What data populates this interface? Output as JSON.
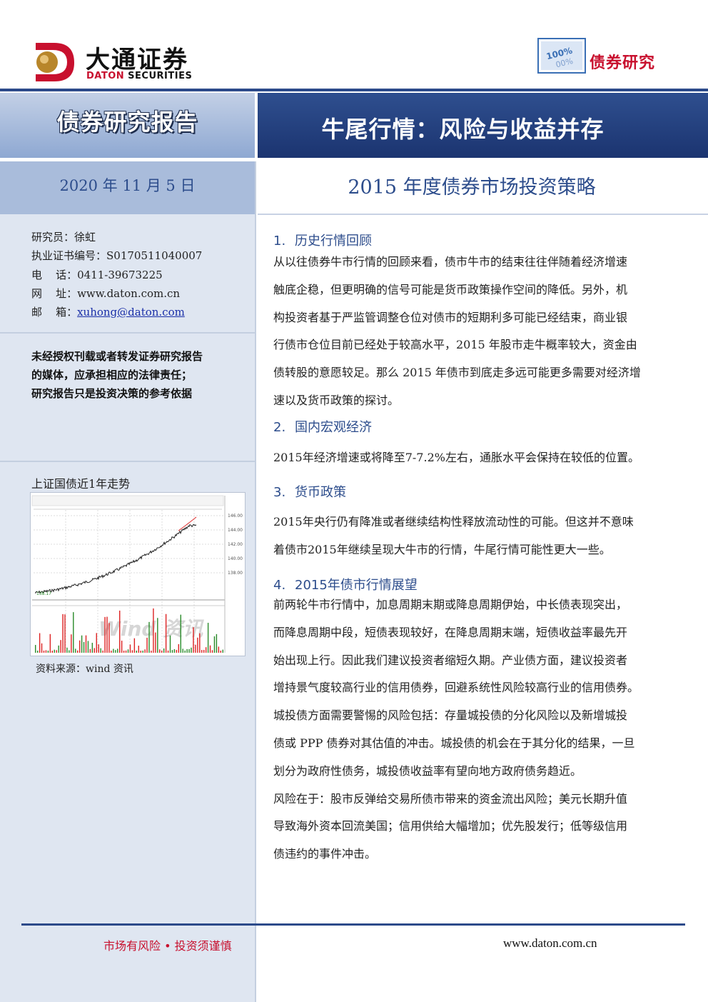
{
  "header": {
    "logo_cn": "大通证券",
    "logo_en_brand": "DATON",
    "logo_en_rest": " SECURITIES",
    "brand_badge_top": "100%",
    "brand_badge_bottom": "00%",
    "brand_text": "债券研究"
  },
  "band": {
    "report_type": "债券研究报告",
    "title": "牛尾行情：风险与收益并存",
    "date": "2020 年 11 月 5 日",
    "subtitle": "2015 年度债券市场投资策略"
  },
  "author": {
    "researcher": "研究员：徐虹",
    "cert": "执业证书编号：S0170511040007",
    "phone": "电    话：0411-39673225",
    "site": "网    址：www.daton.com.cn",
    "email_label": "邮    箱：",
    "email": "xuhong@daton.com"
  },
  "disclaimer": {
    "line1": "未经授权刊载或者转发证券研究报告",
    "line2": "的媒体，应承担相应的法律责任；",
    "line3": "研究报告只是投资决策的参考依据"
  },
  "chart": {
    "title": "上证国债近1年走势",
    "source": "资料来源：wind 资讯",
    "watermark": "Wind 资讯",
    "y_ticks": [
      "146.00",
      "144.00",
      "142.00",
      "140.00",
      "138.00"
    ],
    "start_label": "138.17"
  },
  "sections": [
    {
      "num": "1.",
      "title": "历史行情回顾",
      "lines": [
        "从以往债券牛市行情的回顾来看，债市牛市的结束往往伴随着经济增速",
        "触底企稳，但更明确的信号可能是货币政策操作空间的降低。另外，机",
        "构投资者基于严监管调整仓位对债市的短期利多可能已经结束，商业银",
        "行债市仓位目前已经处于较高水平，2015 年股市走牛概率较大，资金由",
        "债转股的意愿较足。那么 2015 年债市到底走多远可能更多需要对经济增",
        "速以及货币政策的探讨。"
      ]
    },
    {
      "num": "2.",
      "title": "国内宏观经济",
      "lines": [
        "2015年经济增速或将降至7-7.2%左右，通胀水平会保持在较低的位置。"
      ]
    },
    {
      "num": "3.",
      "title": "货币政策",
      "lines": [
        "2015年央行仍有降准或者继续结构性释放流动性的可能。但这并不意味",
        "着债市2015年继续呈现大牛市的行情，牛尾行情可能性更大一些。"
      ]
    },
    {
      "num": "4.",
      "title": "2015年债市行情展望",
      "lines": [
        "前两轮牛市行情中，加息周期末期或降息周期伊始，中长债表现突出，",
        "而降息周期中段，短债表现较好，在降息周期末端，短债收益率最先开",
        "始出现上行。因此我们建议投资者缩短久期。产业债方面，建议投资者",
        "增持景气度较高行业的信用债券，回避系统性风险较高行业的信用债券。",
        "城投债方面需要警惕的风险包括：存量城投债的分化风险以及新增城投",
        "债或 PPP 债券对其估值的冲击。城投债的机会在于其分化的结果，一旦",
        "划分为政府性债务，城投债收益率有望向地方政府债务趋近。",
        "风险在于：股市反弹给交易所债市带来的资金流出风险；美元长期升值",
        "导致海外资本回流美国；信用供给大幅增加；优先股发行；低等级信用",
        "债违约的事件冲击。"
      ]
    }
  ],
  "footer": {
    "left": "市场有风险 • 投资须谨慎",
    "right": "www.daton.com.cn"
  }
}
